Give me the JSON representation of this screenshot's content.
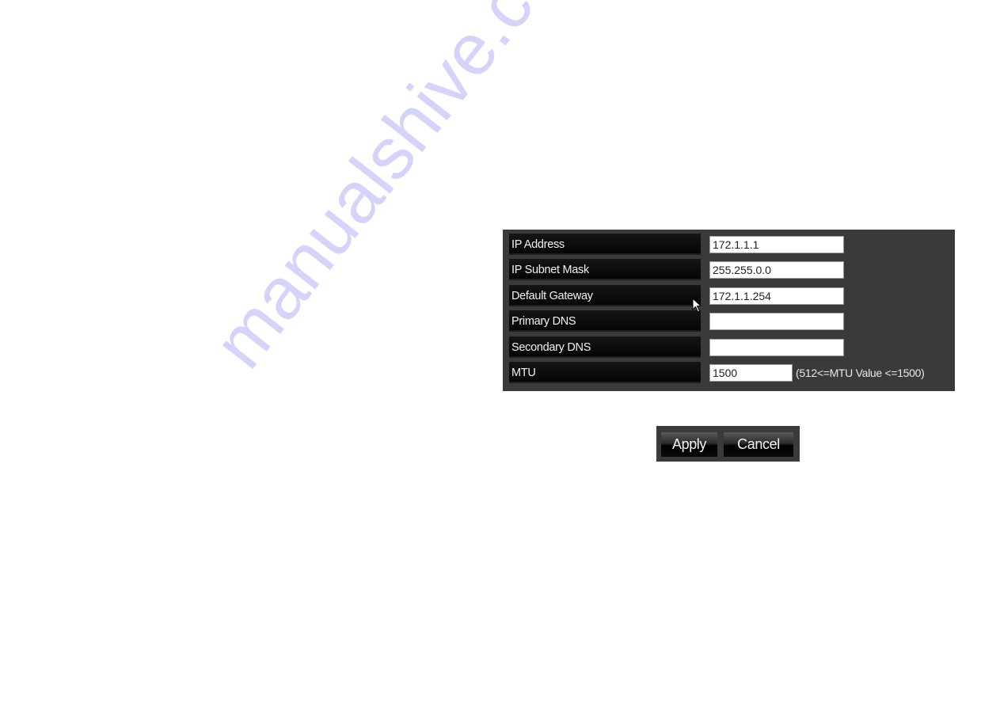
{
  "form": {
    "rows": [
      {
        "label": "IP Address",
        "value": "172.1.1.1"
      },
      {
        "label": "IP Subnet Mask",
        "value": "255.255.0.0"
      },
      {
        "label": "Default Gateway",
        "value": "172.1.1.254"
      },
      {
        "label": "Primary DNS",
        "value": ""
      },
      {
        "label": "Secondary DNS",
        "value": ""
      },
      {
        "label": "MTU",
        "value": "1500",
        "hint": "(512<=MTU Value <=1500)"
      }
    ]
  },
  "buttons": {
    "apply_label": "Apply",
    "cancel_label": "Cancel"
  },
  "watermark": "manualshive.com",
  "colors": {
    "panel_bg": "#3a3a3a",
    "label_bg": "#0a0a0a",
    "watermark": "#7878f0"
  }
}
